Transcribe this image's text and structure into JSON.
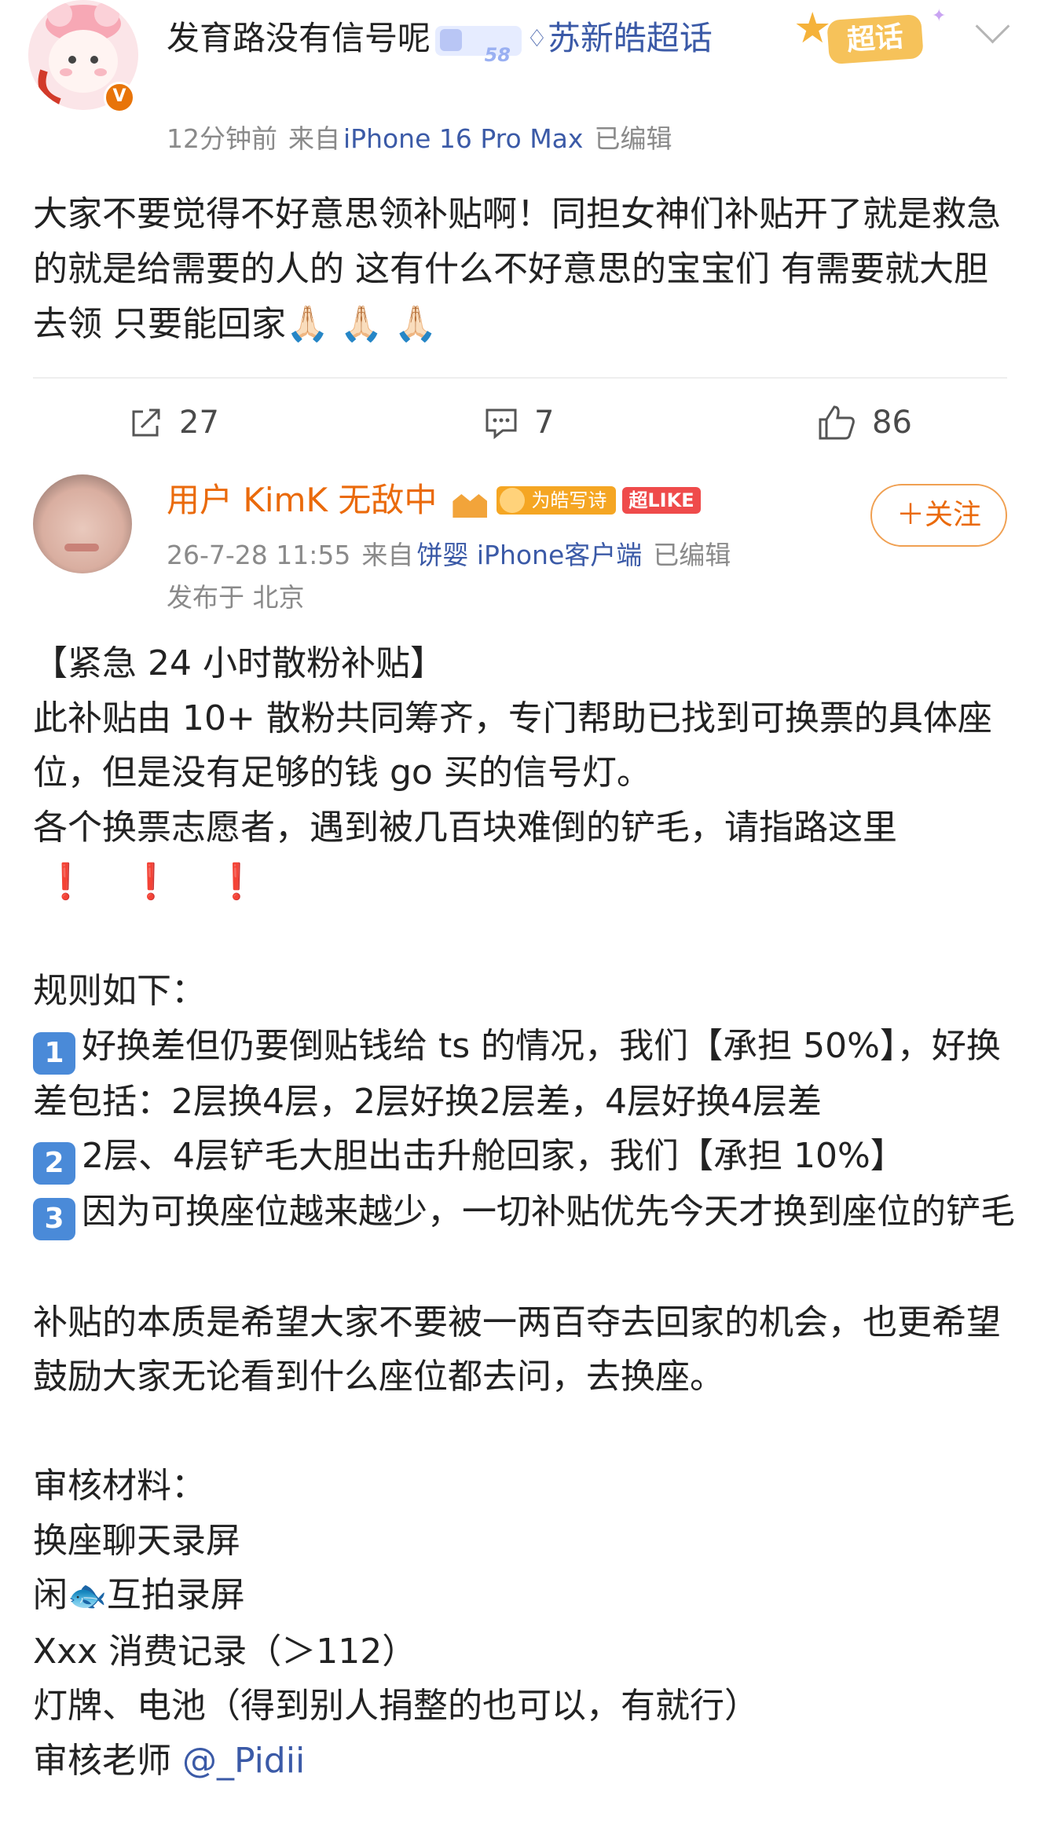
{
  "post1": {
    "username": "发育路没有信号呢",
    "level_badge": "58",
    "topic": "苏新皓超话",
    "super_badge": "超话",
    "time": "12分钟前",
    "source_prefix": "来自",
    "device": "iPhone 16 Pro Max",
    "edited": "已编辑",
    "verified_mark": "V",
    "body": "大家不要觉得不好意思领补贴啊！同担女神们补贴开了就是救急的就是给需要的人的 这有什么不好意思的宝宝们 有需要就大胆去领 只要能回家🙏🏻 🙏🏻 🙏🏻",
    "actions": {
      "shares": "27",
      "comments": "7",
      "likes": "86"
    }
  },
  "post2": {
    "username": "用户 KimK 无敌中",
    "fan_badge": "为皓写诗",
    "like_badge": "超LIKE",
    "follow_label": "＋关注",
    "time": "26-7-28 11:55",
    "source_prefix": "来自",
    "device": "饼婴 iPhone客户端",
    "edited": "已编辑",
    "location": "发布于 北京",
    "lines": {
      "l1": "【紧急 24 小时散粉补贴】",
      "l2": "此补贴由 10+ 散粉共同筹齐，专门帮助已找到可换票的具体座位，但是没有足够的钱 go 买的信号灯。",
      "l3": "各个换票志愿者，遇到被几百块难倒的铲毛，请指路这里",
      "excl": "❗",
      "rules_title": "规则如下：",
      "rule1": "好换差但仍要倒贴钱给 ts 的情况，我们【承担 50%】，好换差包括：2层换4层，2层好换2层差，4层好换4层差",
      "rule2": "2层、4层铲毛大胆出击升舱回家，我们【承担 10%】",
      "rule3": "因为可换座位越来越少，一切补贴优先今天才换到座位的铲毛",
      "key1": "1",
      "key2": "2",
      "key3": "3",
      "essence": "补贴的本质是希望大家不要被一两百夺去回家的机会，也更希望鼓励大家无论看到什么座位都去问，去换座。",
      "review_title": "审核材料：",
      "r1": "换座聊天录屏",
      "r2a": "闲",
      "r2_emoji": "🐟",
      "r2b": "互拍录屏",
      "r3": "Xxx 消费记录（＞112）",
      "r4": "灯牌、电池（得到别人捐整的也可以，有就行）",
      "r5": "审核老师",
      "mention": "@_Pidii"
    }
  },
  "colors": {
    "orange_name": "#ea6a0b",
    "link_blue": "#3b5aa7",
    "meta_gray": "#8a8a8a",
    "excl_red": "#e0211b"
  }
}
